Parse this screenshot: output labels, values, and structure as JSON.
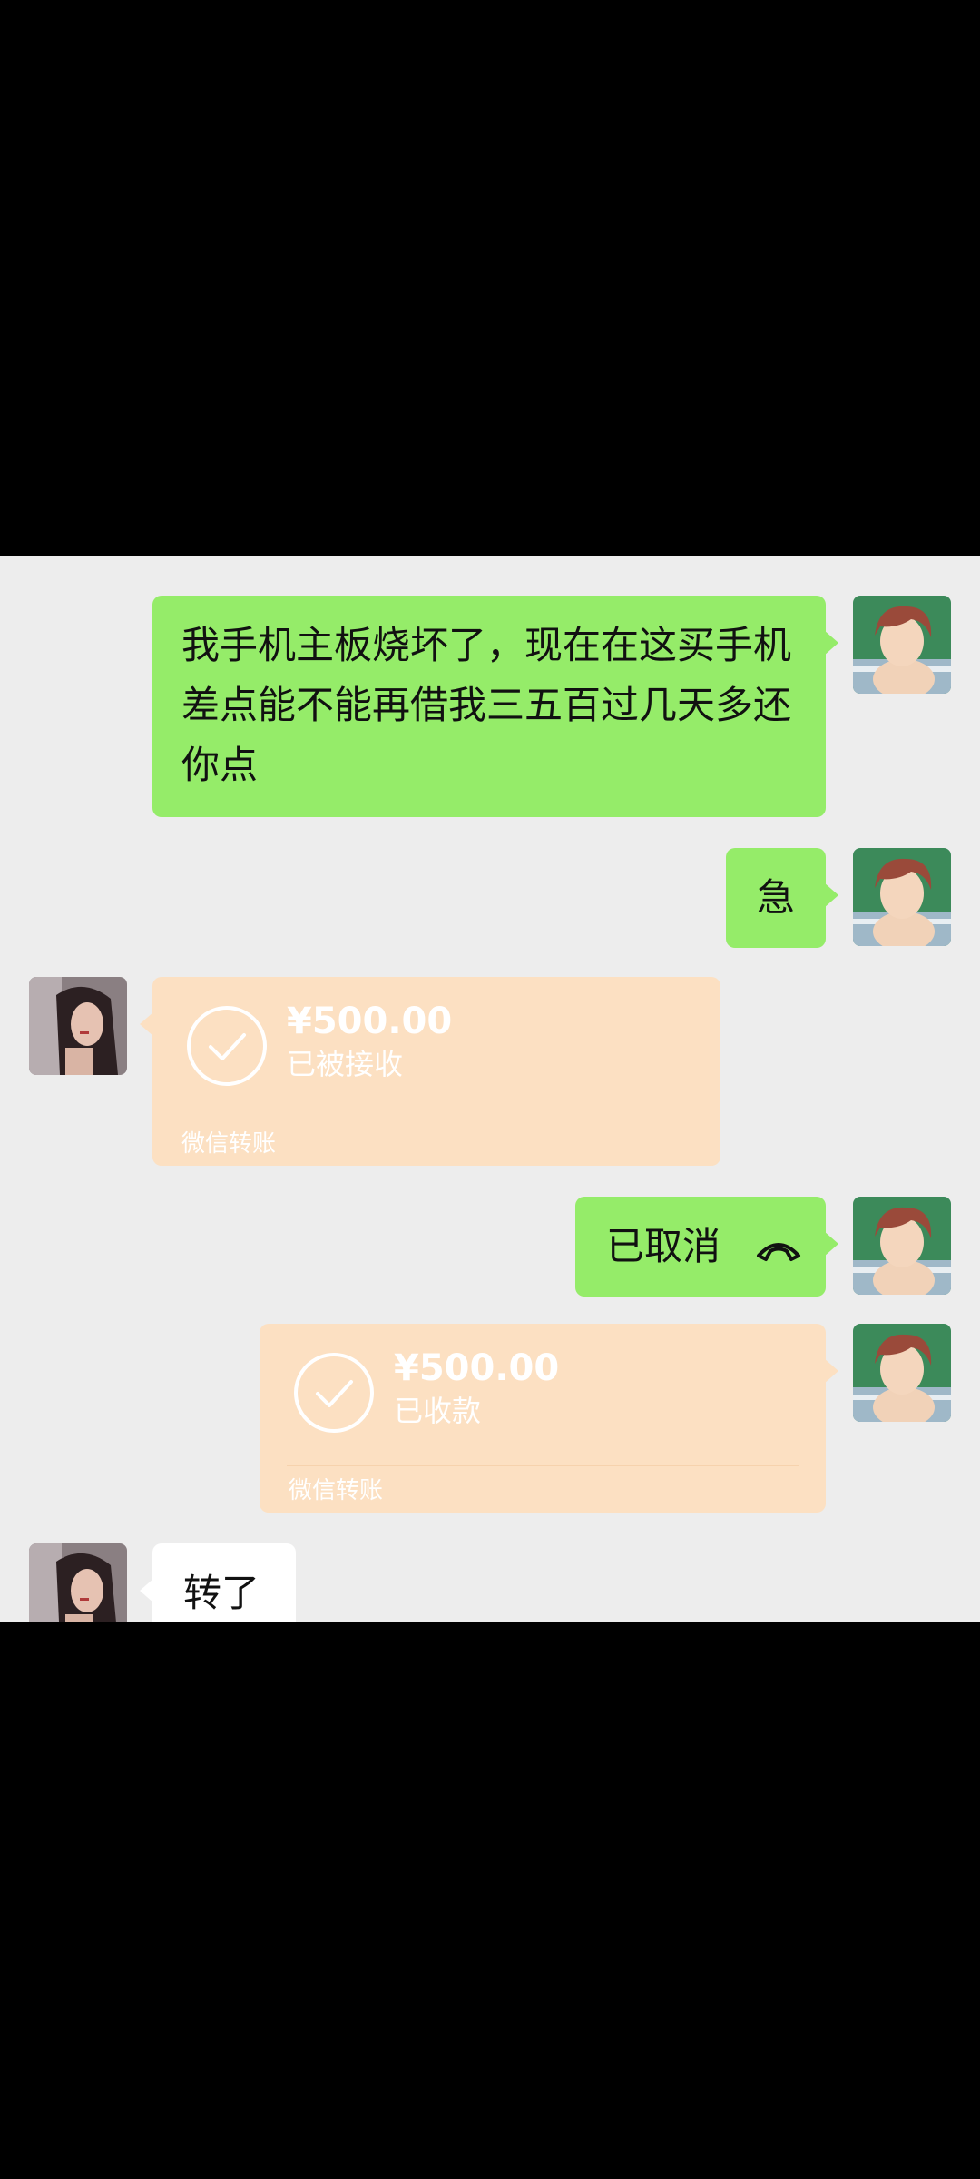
{
  "messages": {
    "m1": {
      "text": "我手机主板烧坏了，现在在这买手机差点能不能再借我三五百过几天多还你点"
    },
    "m2": {
      "text": "急"
    },
    "transfer_in": {
      "amount": "¥500.00",
      "status": "已被接收",
      "footer": "微信转账"
    },
    "call": {
      "text": "已取消"
    },
    "transfer_out": {
      "amount": "¥500.00",
      "status": "已收款",
      "footer": "微信转账"
    },
    "m3": {
      "text": "转了"
    }
  },
  "colors": {
    "chat_bg": "#ededed",
    "sent_bubble": "#95ec69",
    "received_bubble": "#ffffff",
    "transfer_card": "#fce0c2"
  },
  "icons": {
    "call": "call-icon",
    "check": "checkmark-circle-icon"
  }
}
